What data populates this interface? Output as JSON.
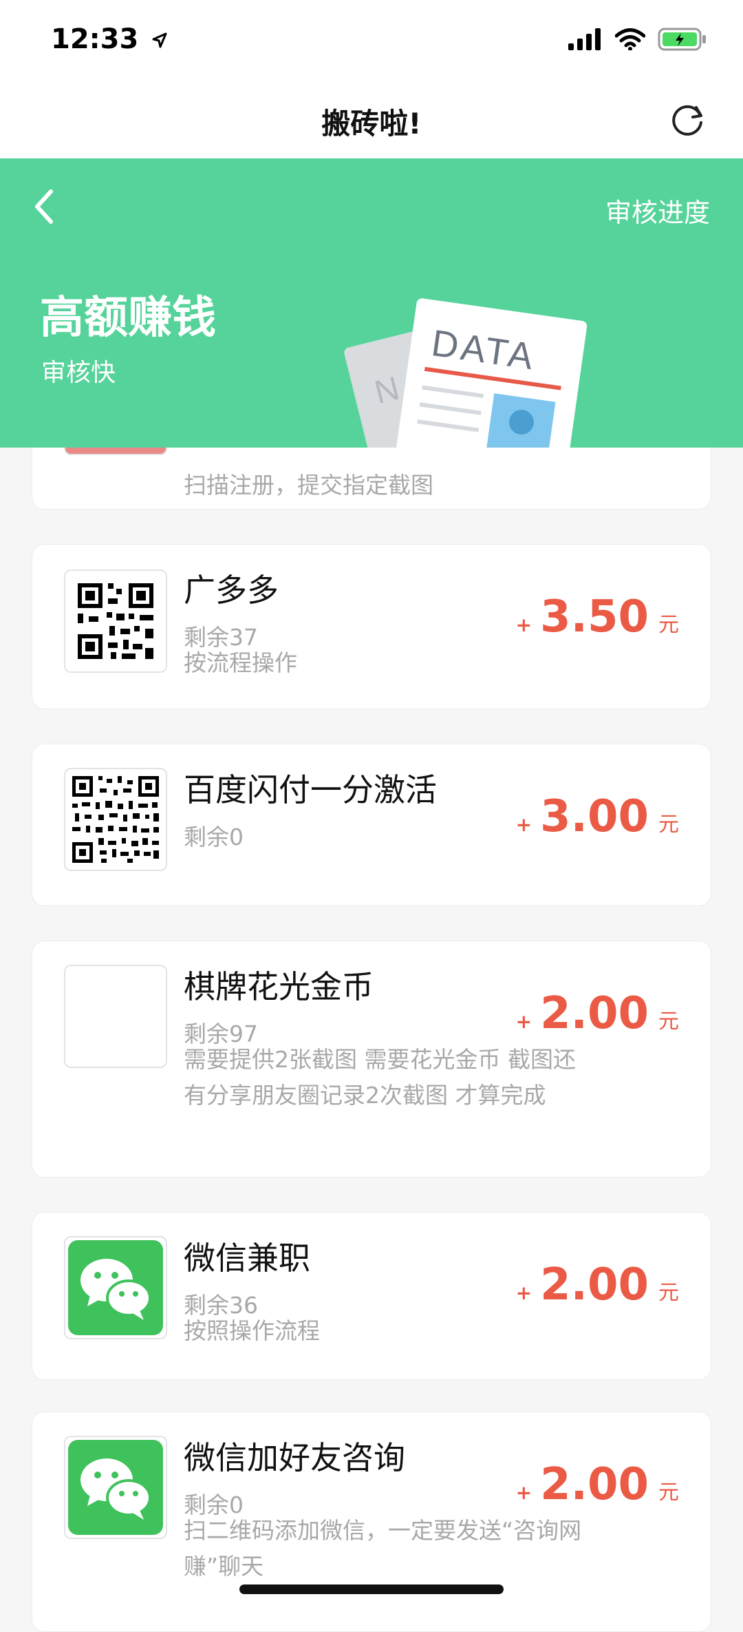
{
  "status": {
    "time": "12:33"
  },
  "nav": {
    "title": "搬砖啦!"
  },
  "hero": {
    "progress_label": "审核进度",
    "title": "高额赚钱",
    "subtitle": "审核快",
    "illustration_text": "DATA"
  },
  "tasks": [
    {
      "title": "",
      "remain": "",
      "desc": "扫描注册，提交指定截图",
      "reward": "",
      "unit": "",
      "plus": ""
    },
    {
      "title": "广多多",
      "remain": "剩余37",
      "desc": "按流程操作",
      "reward": "3.50",
      "unit": "元",
      "plus": "+"
    },
    {
      "title": "百度闪付一分激活",
      "remain": "剩余0",
      "desc": "",
      "reward": "3.00",
      "unit": "元",
      "plus": "+"
    },
    {
      "title": "棋牌花光金币",
      "remain": "剩余97",
      "desc": "需要提供2张截图 需要花光金币 截图还有分享朋友圈记录2次截图 才算完成",
      "reward": "2.00",
      "unit": "元",
      "plus": "+"
    },
    {
      "title": "微信兼职",
      "remain": "剩余36",
      "desc": "按照操作流程",
      "reward": "2.00",
      "unit": "元",
      "plus": "+"
    },
    {
      "title": "微信加好友咨询",
      "remain": "剩余0",
      "desc": "扫二维码添加微信，一定要发送“咨询网赚”聊天",
      "reward": "2.00",
      "unit": "元",
      "plus": "+"
    }
  ],
  "colors": {
    "accent": "#55d39a",
    "price": "#ea5a45",
    "wechat": "#3fc15b"
  },
  "icons": [
    "location-arrow-icon",
    "signal-icon",
    "wifi-icon",
    "battery-icon",
    "refresh-icon",
    "chevron-left-icon",
    "qr-code-icon",
    "wechat-icon"
  ]
}
